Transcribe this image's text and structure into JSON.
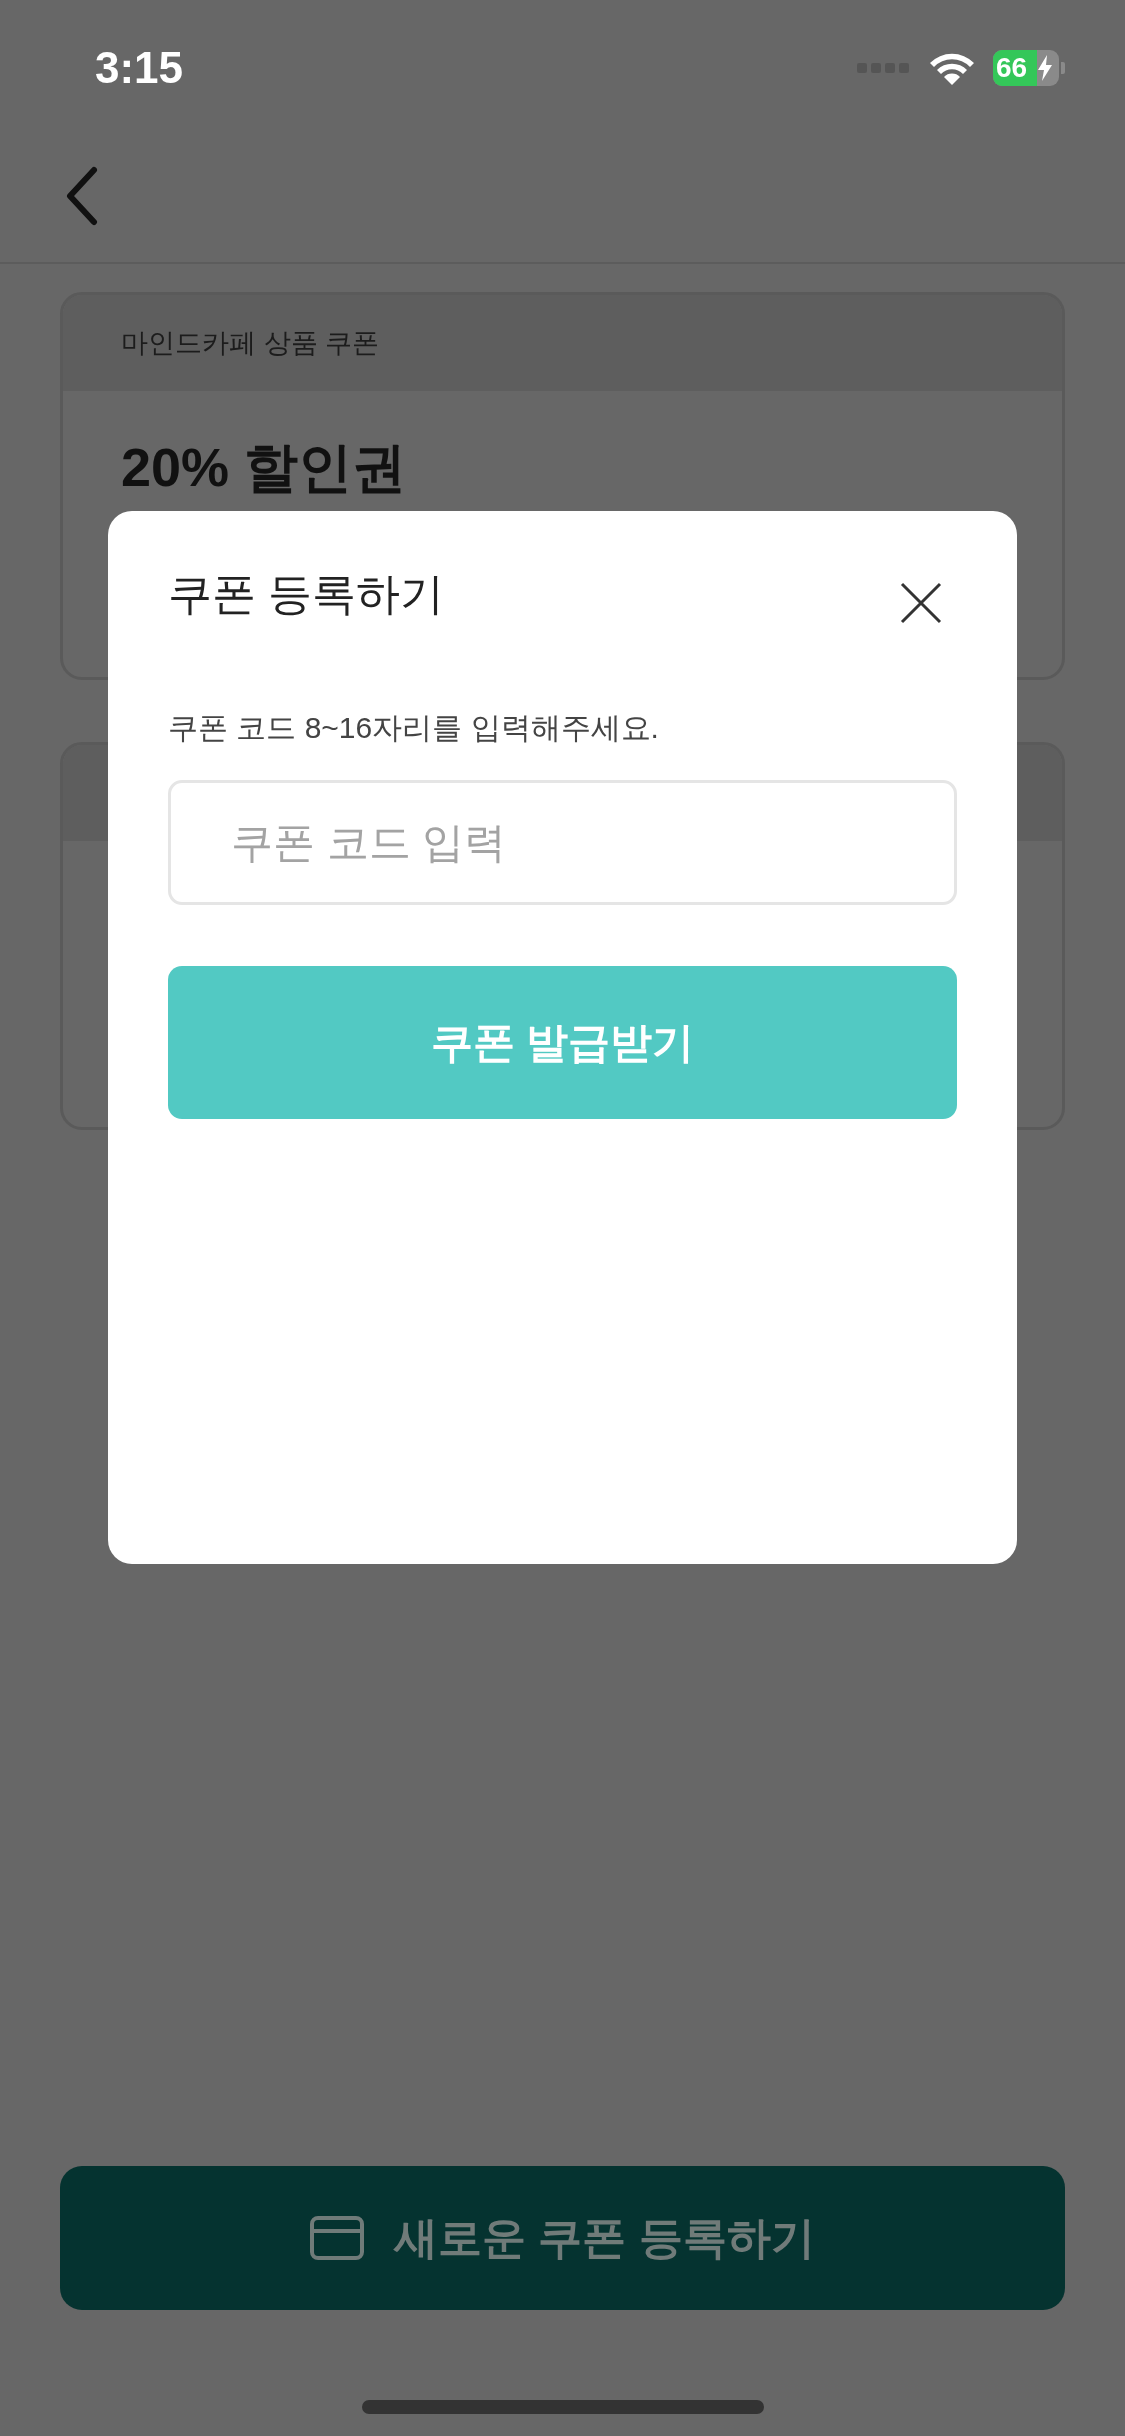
{
  "status_bar": {
    "time": "3:15",
    "battery": "66"
  },
  "coupons": [
    {
      "kind": "full",
      "header": "마인드카페 상품 쿠폰",
      "title": "20% 할인권"
    },
    {
      "kind": "covered"
    }
  ],
  "modal": {
    "title": "쿠폰 등록하기",
    "hint": "쿠폰 코드 8~16자리를 입력해주세요.",
    "placeholder": "쿠폰 코드 입력",
    "submit": "쿠폰 발급받기"
  },
  "bottom_button": "새로운 쿠폰 등록하기"
}
